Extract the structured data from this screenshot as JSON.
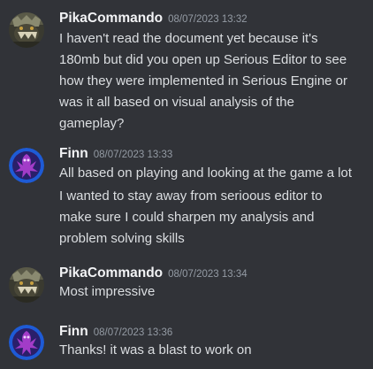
{
  "messages": [
    {
      "username": "PikaCommando",
      "timestamp": "08/07/2023 13:32",
      "avatar_icon": "armored-creature-avatar",
      "lines": [
        "I haven't read the document yet because it's",
        "180mb but did you open up Serious Editor to see",
        "how they were implemented in Serious Engine or",
        "was it all based on visual analysis of the",
        "gameplay?"
      ]
    },
    {
      "username": "Finn",
      "timestamp": "08/07/2023 13:33",
      "avatar_icon": "purple-creature-avatar",
      "lines": [
        "All based on playing and looking at the game a lot"
      ],
      "followup_lines": [
        "I wanted to stay away from serioous editor to",
        "make sure I could sharpen my analysis and",
        "problem solving skills"
      ]
    },
    {
      "username": "PikaCommando",
      "timestamp": "08/07/2023 13:34",
      "avatar_icon": "armored-creature-avatar",
      "lines": [
        "Most impressive"
      ]
    },
    {
      "username": "Finn",
      "timestamp": "08/07/2023 13:36",
      "avatar_icon": "purple-creature-avatar",
      "lines": [
        "Thanks! it was a blast to work on"
      ]
    }
  ],
  "colors": {
    "background": "#313338",
    "username": "#f2f3f5",
    "timestamp": "#949ba4",
    "text": "#dbdee1",
    "finn_avatar_ring": "#1e5bd6",
    "finn_avatar_creature": "#a23cc8"
  }
}
